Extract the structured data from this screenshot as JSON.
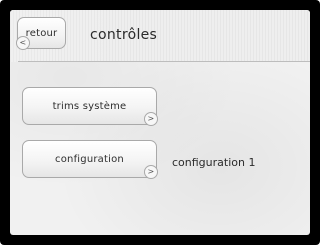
{
  "header": {
    "title": "contrôles",
    "back_label": "retour",
    "back_chevron": "<"
  },
  "menu": {
    "items": [
      {
        "label": "trims système",
        "chevron": ">"
      },
      {
        "label": "configuration",
        "chevron": ">",
        "value": "configuration 1"
      }
    ]
  },
  "colors": {
    "frame": "#000000",
    "screen_background": "#f1f1f1",
    "button_border": "#a9a9a9",
    "text": "#2e2e2e"
  },
  "icons": {
    "back": "chevron-left-icon",
    "next": "chevron-right-icon"
  }
}
